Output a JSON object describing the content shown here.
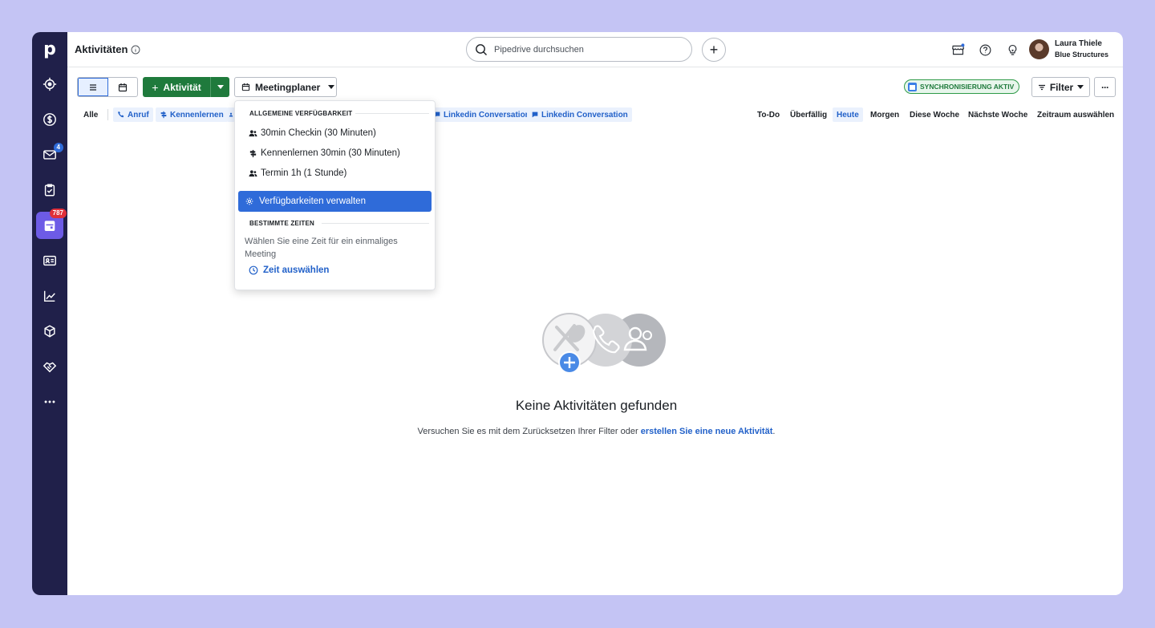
{
  "sidebar": {
    "logo": "p",
    "items": [
      {
        "name": "target",
        "badge": ""
      },
      {
        "name": "deals",
        "badge": ""
      },
      {
        "name": "mail",
        "badge": "4"
      },
      {
        "name": "tasks",
        "badge": ""
      },
      {
        "name": "activities",
        "badge": "787"
      },
      {
        "name": "contacts",
        "badge": ""
      },
      {
        "name": "insights",
        "badge": ""
      },
      {
        "name": "products",
        "badge": ""
      },
      {
        "name": "partners",
        "badge": ""
      },
      {
        "name": "more",
        "badge": ""
      }
    ]
  },
  "header": {
    "title": "Aktivitäten",
    "search_placeholder": "Pipedrive durchsuchen",
    "user_name": "Laura Thiele",
    "user_company": "Blue Structures"
  },
  "toolbar": {
    "add_activity_label": "Aktivität",
    "meeting_label": "Meetingplaner",
    "sync_label": "SYNCHRONISIERUNG AKTIV",
    "filter_label": "Filter",
    "more_label": "···"
  },
  "type_filters": {
    "all": "Alle",
    "call": "Anruf",
    "meeting": "Kennenlernen",
    "linkedin1": "Linkedin Conversation",
    "linkedin2": "Linkedin Conversation"
  },
  "periods": {
    "todo": "To-Do",
    "overdue": "Überfällig",
    "today": "Heute",
    "tomorrow": "Morgen",
    "this_week": "Diese Woche",
    "next_week": "Nächste Woche",
    "range": "Zeitraum auswählen"
  },
  "dropdown": {
    "section_general": "ALLGEMEINE VERFÜGBARKEIT",
    "item1": "30min Checkin (30 Minuten)",
    "item2": "Kennenlernen 30min (30 Minuten)",
    "item3": "Termin 1h (1 Stunde)",
    "manage": "Verfügbarkeiten verwalten",
    "section_specific": "BESTIMMTE ZEITEN",
    "description": "Wählen Sie eine Zeit für ein einmaliges Meeting",
    "pick_time": "Zeit auswählen"
  },
  "empty": {
    "title": "Keine Aktivitäten gefunden",
    "text_before": "Versuchen Sie es mit dem Zurücksetzen Ihrer Filter oder ",
    "link": "erstellen Sie eine neue Aktivität",
    "text_after": "."
  },
  "colors": {
    "sidebar": "#20204a",
    "accent": "#2f6bd9",
    "primary_green": "#1f7a3c",
    "active_nav": "#6d5be6"
  }
}
